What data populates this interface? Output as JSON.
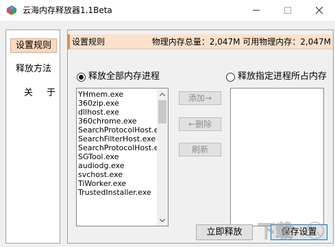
{
  "window": {
    "title": "云海内存释放器1.1Beta",
    "controls": {
      "minimize": "—",
      "maximize": "☐",
      "close": "✕"
    }
  },
  "sidebar": {
    "items": [
      {
        "label": "设置规则",
        "active": true
      },
      {
        "label": "释放方法",
        "active": false
      },
      {
        "label": "关于",
        "active": false
      }
    ]
  },
  "info": {
    "section": "设置规则",
    "memory_text": "物理内存总量：2,047M 可用物理内存：2,047M"
  },
  "options": {
    "release_all": {
      "label": "释放全部内存进程",
      "checked": true
    },
    "release_selected": {
      "label": "释放指定进程所占内存",
      "checked": false
    }
  },
  "processes": [
    "YHmem.exe",
    "360zip.exe",
    "dllhost.exe",
    "360chrome.exe",
    "SearchProtocolHost.exe",
    "SearchFilterHost.exe",
    "SearchProtocolHost.exe",
    "SGTool.exe",
    "audiodg.exe",
    "svchost.exe",
    "TiWorker.exe",
    "TrustedInstaller.exe"
  ],
  "middle_buttons": {
    "add": "添加→",
    "remove": "←删除",
    "refresh": "刷新"
  },
  "bottom_buttons": {
    "release_now": "立即释放",
    "save_settings": "保存设置"
  },
  "colors": {
    "accent_bg": "#fbe1cc",
    "accent_border": "#e28a4d",
    "active_item_bg": "#f9d9c0"
  }
}
